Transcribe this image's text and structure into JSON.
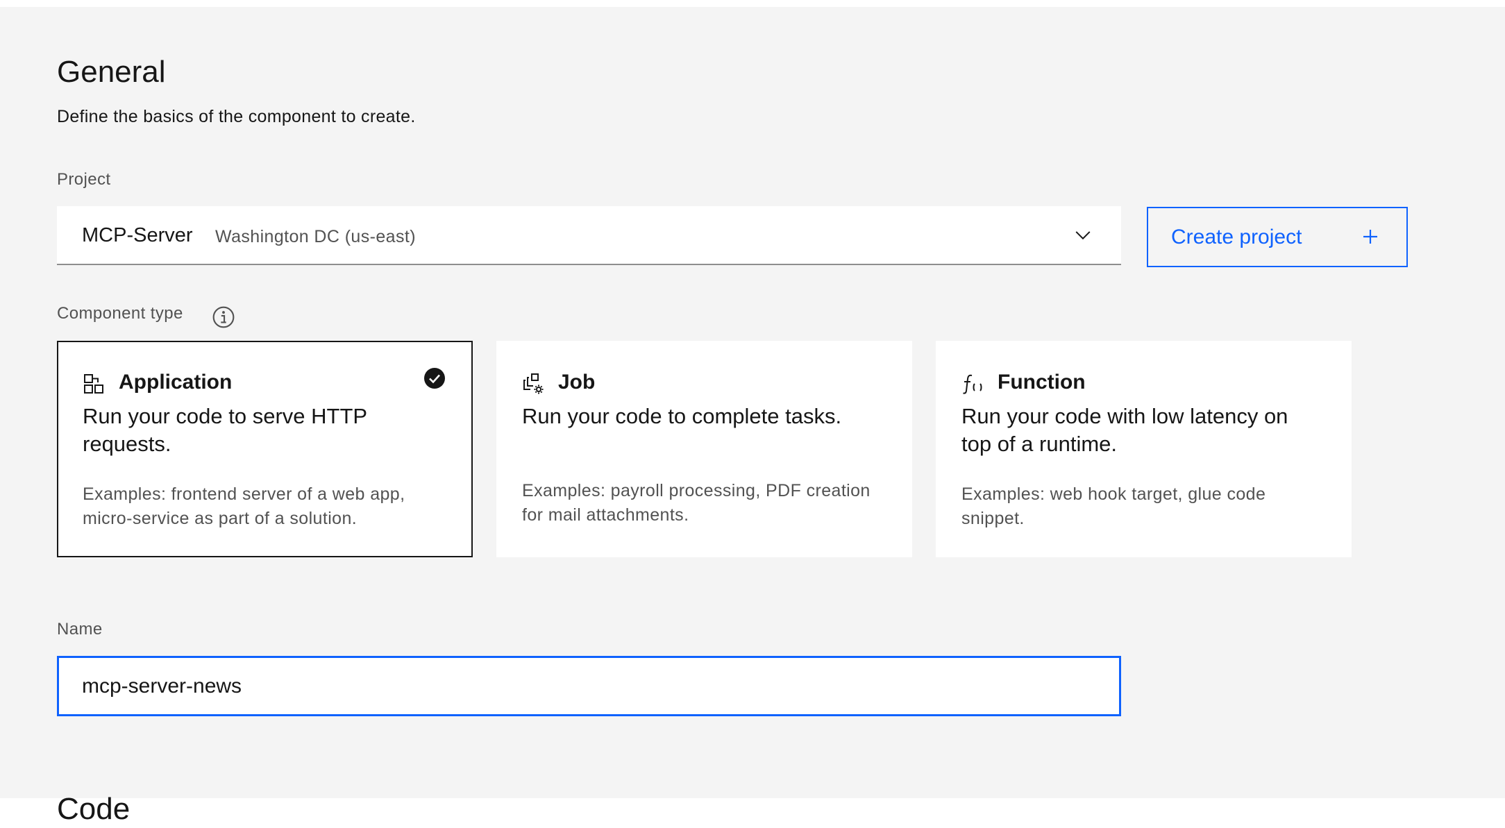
{
  "general": {
    "title": "General",
    "description": "Define the basics of the component to create."
  },
  "project": {
    "label": "Project",
    "selected_name": "MCP-Server",
    "selected_region": "Washington DC (us-east)",
    "create_button_label": "Create project"
  },
  "component_type": {
    "label": "Component type",
    "cards": [
      {
        "icon": "application-icon",
        "title": "Application",
        "description": "Run your code to serve HTTP requests.",
        "examples": "Examples: frontend server of a web app, micro-service as part of a solution.",
        "selected": true
      },
      {
        "icon": "job-icon",
        "title": "Job",
        "description": "Run your code to complete tasks.",
        "examples": "Examples: payroll processing, PDF creation for mail attachments.",
        "selected": false
      },
      {
        "icon": "function-icon",
        "title": "Function",
        "description": "Run your code with low latency on top of a runtime.",
        "examples": "Examples: web hook target, glue code snippet.",
        "selected": false
      }
    ]
  },
  "name": {
    "label": "Name",
    "value": "mcp-server-news"
  },
  "next_section": {
    "title": "Code"
  },
  "colors": {
    "page_background": "#f4f4f4",
    "card_background": "#ffffff",
    "accent_blue": "#0f62fe",
    "text_primary": "#161616",
    "text_secondary": "#525252",
    "selected_border": "#161616"
  }
}
